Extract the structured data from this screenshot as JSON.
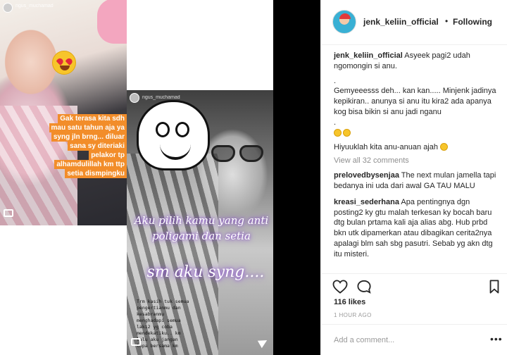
{
  "stories": {
    "left": {
      "user": "ngus_muchamad",
      "caption": "Gak terasa kita sdh mau satu tahun aja ya syng jln brng... diluar sana sy diteriaki pelakor tp alhamdulillah km ttp setia dismpingku"
    },
    "right": {
      "user": "ngus_muchamad",
      "script_line_1": "Aku pilih kamu yang anti poligami dan setia",
      "script_line_2": "sm aku syng....",
      "typed_note": "Trm kasih tuk semua\npengertianmu dan\nkesabranmu\nmenghadapi semua\nlaki2 yg coba\nmendekatiku.. km\nlalu aku jangan\nlupa bersama km"
    }
  },
  "header": {
    "username": "jenk_keliin_official",
    "separator": "•",
    "follow_status": "Following"
  },
  "caption": {
    "username": "jenk_keliin_official",
    "text_1": "Asyeek pagi2 udah ngomongin si anu.",
    "text_2": ".",
    "text_3": "Gemyeeesss deh... kan kan..... Minjenk jadinya kepikiran.. anunya si anu itu kira2 ada apanya kog bisa bikin si anu jadi nganu",
    "text_4": ".",
    "text_5": "Hiyuuklah kita anu-anuan ajah"
  },
  "view_all": "View all 32 comments",
  "comments": [
    {
      "username": "prelovedbysenjaa",
      "text": "The next mulan jamella tapi bedanya ini uda dari awal GA TAU MALU"
    },
    {
      "username": "kreasi_sederhana",
      "text": "Apa pentingnya dgn posting2 ky gtu malah terkesan ky bocah baru dtg bulan prtama kali aja alias abg. Hub prbd bkn utk dipamerkan atau dibagikan cerita2nya apalagi blm sah sbg pasutri. Sebab yg akn dtg itu misteri."
    }
  ],
  "likes": "116 likes",
  "timestamp": "1 HOUR AGO",
  "add_comment": {
    "placeholder": "Add a comment...",
    "more": "•••"
  },
  "icons": [
    "heart-icon",
    "comment-icon",
    "bookmark-icon",
    "camera-icon",
    "send-icon"
  ],
  "colors": {
    "caption_bg": "#f28d2a",
    "script_glow": "#8a4fd1",
    "muted": "#8e8e8e"
  }
}
